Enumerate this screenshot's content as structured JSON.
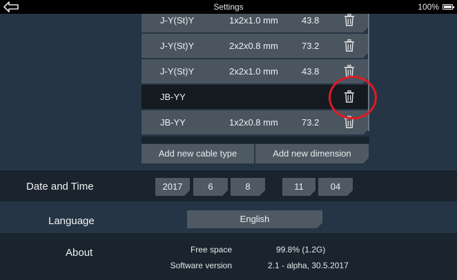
{
  "status_bar": {
    "title": "Settings",
    "battery_percent": "100%",
    "back_icon": "back-arrow-icon",
    "battery_icon": "battery-icon"
  },
  "cables": [
    {
      "type": "J-Y(St)Y",
      "dimension": "1x2x1.0 mm",
      "value": "43.8"
    },
    {
      "type": "J-Y(St)Y",
      "dimension": "2x2x0.8 mm",
      "value": "73.2"
    },
    {
      "type": "J-Y(St)Y",
      "dimension": "2x2x1.0 mm",
      "value": "43.8"
    },
    {
      "type": "JB-YY",
      "dimension": "",
      "value": ""
    },
    {
      "type": "JB-YY",
      "dimension": "1x2x0.8 mm",
      "value": "73.2"
    }
  ],
  "actions": {
    "add_cable_type": "Add new cable type",
    "add_dimension": "Add new dimension"
  },
  "date_time": {
    "label": "Date and Time",
    "year": "2017",
    "month": "6",
    "day": "8",
    "hour": "11",
    "minute": "04"
  },
  "language": {
    "label": "Language",
    "selected": "English"
  },
  "about": {
    "label": "About",
    "free_space_label": "Free space",
    "free_space_value": "99.8% (1.2G)",
    "software_version_label": "Software version",
    "software_version_value": "2.1 - alpha, 30.5.2017"
  },
  "colors": {
    "background": "#263545",
    "row_dark": "#1a242e",
    "item": "#4b5560",
    "selected_item": "#151a20",
    "highlight": "#e01b24"
  }
}
